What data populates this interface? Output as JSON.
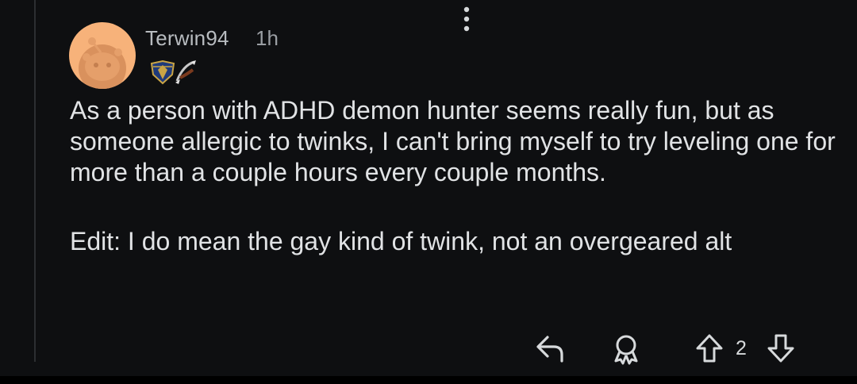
{
  "comment": {
    "username": "Terwin94",
    "time": "1h",
    "flair_icons": [
      "alliance-crest-icon",
      "glaive-icon"
    ],
    "body": [
      "As a person with ADHD demon hunter seems really fun, but as someone allergic to twinks, I can't bring myself to try leveling one for more than a couple hours every couple months.",
      "Edit: I do mean the gay kind of twink, not an overgeared alt"
    ],
    "score": "2"
  },
  "actions": {
    "icons": [
      "more-options-icon",
      "reply-icon",
      "award-icon",
      "upvote-icon",
      "downvote-icon"
    ]
  },
  "colors": {
    "background": "#0e0f11",
    "avatar_bg": "#f7b27a",
    "text": "#e1e3e5",
    "meta": "#b8bcc0"
  }
}
